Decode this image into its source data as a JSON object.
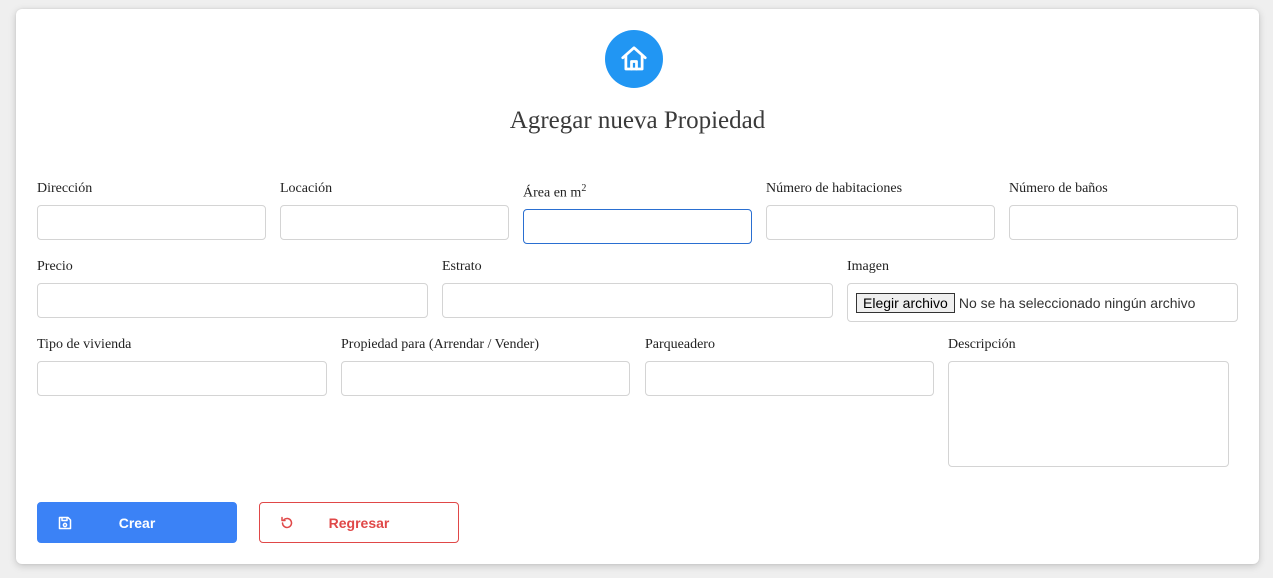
{
  "header": {
    "icon": "home-icon",
    "title": "Agregar nueva Propiedad",
    "accent_color": "#2196f3"
  },
  "form": {
    "direccion": {
      "label": "Dirección",
      "value": ""
    },
    "locacion": {
      "label": "Locación",
      "value": ""
    },
    "area": {
      "label": "Área en m",
      "label_sup": "2",
      "value": ""
    },
    "habitaciones": {
      "label": "Número de habitaciones",
      "value": ""
    },
    "banos": {
      "label": "Número de baños",
      "value": ""
    },
    "precio": {
      "label": "Precio",
      "value": ""
    },
    "estrato": {
      "label": "Estrato",
      "value": ""
    },
    "imagen": {
      "label": "Imagen",
      "button_label": "Elegir archivo",
      "status": "No se ha seleccionado ningún archivo"
    },
    "tipo_vivienda": {
      "label": "Tipo de vivienda",
      "value": ""
    },
    "propiedad_para": {
      "label": "Propiedad para (Arrendar / Vender)",
      "value": ""
    },
    "parqueadero": {
      "label": "Parqueadero",
      "value": ""
    },
    "descripcion": {
      "label": "Descripción",
      "value": ""
    }
  },
  "actions": {
    "crear": {
      "label": "Crear",
      "icon": "save-icon",
      "color": "#3b82f6"
    },
    "regresar": {
      "label": "Regresar",
      "icon": "undo-icon",
      "color": "#e04848"
    }
  }
}
